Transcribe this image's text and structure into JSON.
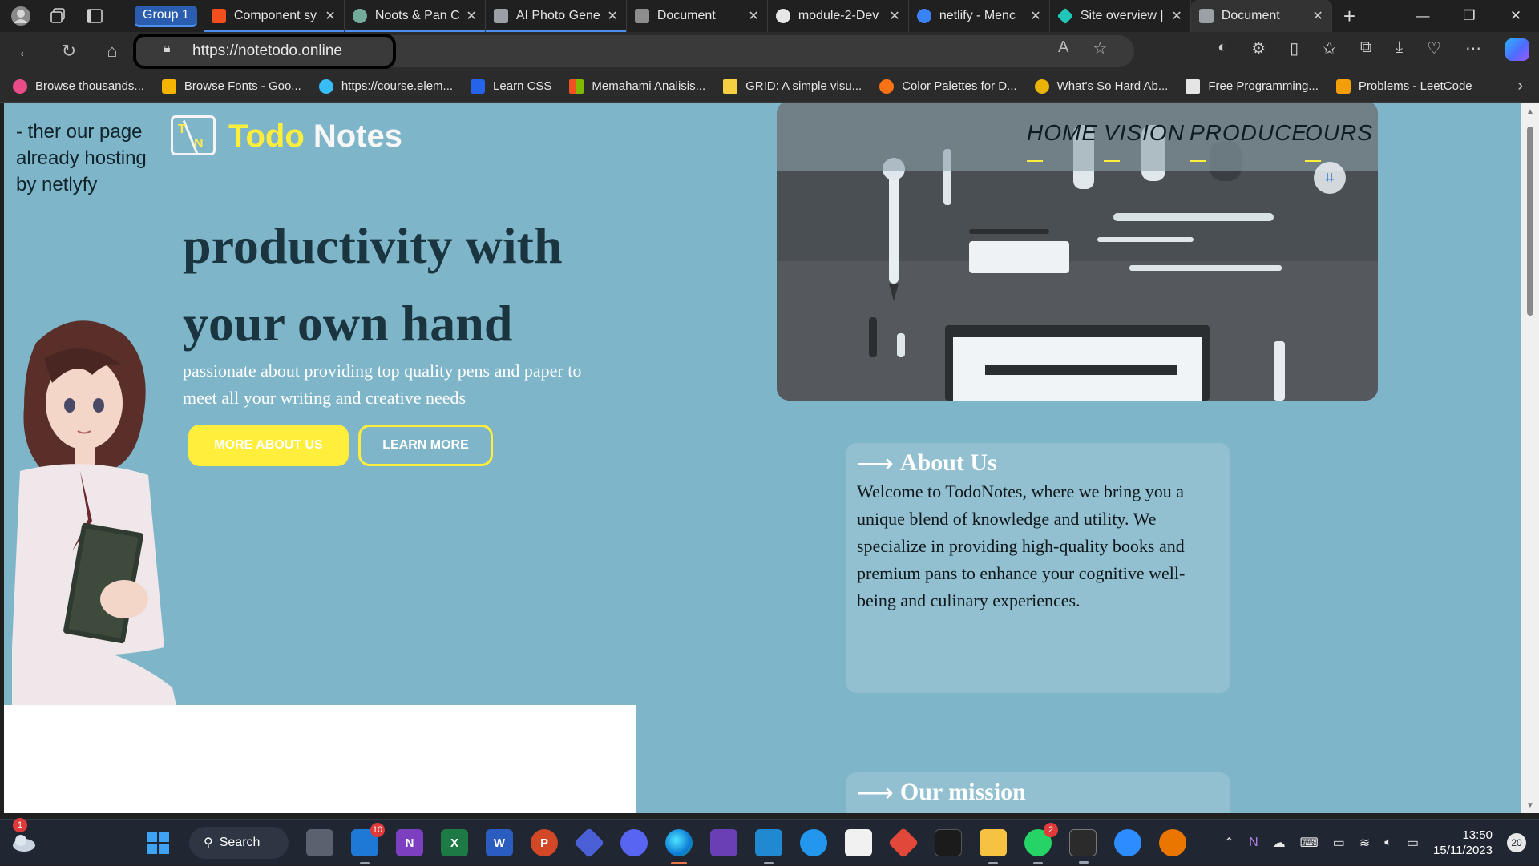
{
  "browser": {
    "tab_group_label": "Group 1",
    "tabs": [
      {
        "label": "Component sy",
        "icon": "figma-icon",
        "color": "#f24e1e",
        "grouped": true
      },
      {
        "label": "Noots & Pan C",
        "icon": "chatgpt-icon",
        "color": "#74aa9c",
        "grouped": true
      },
      {
        "label": "AI Photo Gene",
        "icon": "grid-icon",
        "color": "#9aa0a6",
        "grouped": true
      },
      {
        "label": "Document",
        "icon": "ntd-icon",
        "color": "#8d8d8d",
        "grouped": false
      },
      {
        "label": "module-2-Dev",
        "icon": "github-icon",
        "color": "#e6e6e6",
        "grouped": false
      },
      {
        "label": "netlify - Menc",
        "icon": "search-icon",
        "color": "#3b82f6",
        "grouped": false
      },
      {
        "label": "Site overview |",
        "icon": "netlify-icon",
        "color": "#20c6b7",
        "grouped": false
      },
      {
        "label": "Document",
        "icon": "td-icon",
        "color": "#9aa0a6",
        "grouped": false,
        "active": true
      }
    ],
    "new_tab": "+",
    "url": "https://notetodo.online"
  },
  "bookmarks": [
    {
      "label": "Browse thousands...",
      "icon": "dribbble-icon",
      "color": "#ea4c89"
    },
    {
      "label": "Browse Fonts - Goo...",
      "icon": "google-fonts-icon",
      "color": "#f4b400"
    },
    {
      "label": "https://course.elem...",
      "icon": "globe-icon",
      "color": "#38bdf8"
    },
    {
      "label": "Learn CSS",
      "icon": "css-icon",
      "color": "#2563eb"
    },
    {
      "label": "Memahami Analisis...",
      "icon": "microsoft-icon",
      "color": "#f25022"
    },
    {
      "label": "GRID: A simple visu...",
      "icon": "grid-icon",
      "color": "#f5d142"
    },
    {
      "label": "Color Palettes for D...",
      "icon": "palette-icon",
      "color": "#f97316"
    },
    {
      "label": "What's So Hard Ab...",
      "icon": "circle-icon",
      "color": "#eab308"
    },
    {
      "label": "Free Programming...",
      "icon": "bookmark-icon",
      "color": "#e5e5e5"
    },
    {
      "label": "Problems - LeetCode",
      "icon": "leetcode-icon",
      "color": "#f59e0b"
    }
  ],
  "page": {
    "side_note": "- ther our page already hosting by netlyfy",
    "logo_letters": [
      "T",
      "N"
    ],
    "brand_word1": "Todo",
    "brand_word2": "Notes",
    "hero_title": "productivity with your own hand",
    "hero_subtitle": "passionate about providing top quality pens and paper to meet all your writing and creative needs",
    "btn_primary": "MORE ABOUT US",
    "btn_secondary": "LEARN MORE",
    "nav": [
      "HOME",
      "VISION",
      "PRODUCE",
      "OURS"
    ],
    "about_title": "About Us",
    "about_body": "Welcome to TodoNotes, where we bring you a unique blend of knowledge and utility. We specialize in providing high-quality books and premium pans to enhance your cognitive well-being and culinary experiences.",
    "mission_title": "Our mission",
    "colors": {
      "accent": "#ffee3b",
      "background": "#7eb5c8",
      "heading": "#1a3540"
    }
  },
  "taskbar": {
    "search_label": "Search",
    "weather_badge": "1",
    "mail_badge": "10",
    "whatsapp_badge": "2",
    "time": "13:50",
    "date": "15/11/2023",
    "notification_count": "20"
  }
}
